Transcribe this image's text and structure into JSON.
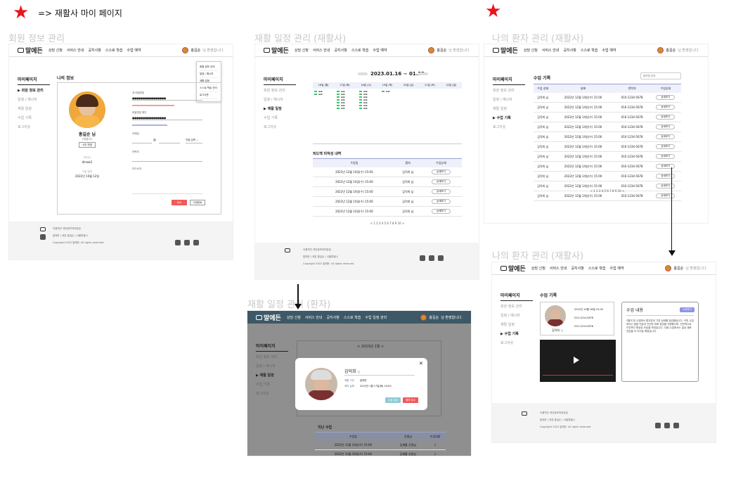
{
  "header": {
    "title": "=> 재활사 마이 페이지"
  },
  "sections": {
    "member_info": "회원 정보 관리",
    "schedule_therapist": "재활 일정 관리 (재활사)",
    "patient_mgmt": "나의 환자 관리 (재활사)",
    "schedule_patient": "재활 일정 관리 (환자)",
    "patient_mgmt2": "나의 환자 관리 (재활사)"
  },
  "nav": {
    "logo": "말에든",
    "menu": [
      "상담 신청",
      "서비스 안내",
      "공지사항",
      "스스로 학습",
      "수업 예약"
    ],
    "menu_patient": [
      "상담 신청",
      "서비스 안내",
      "공지사항",
      "스스로 학습",
      "수업 일정 관리"
    ],
    "user": "홍길순",
    "user_suffix": "님 환영합니다."
  },
  "sidebar": {
    "title": "마이페이지",
    "items": [
      "회원 정보 관리",
      "일정 / 예시자",
      "재활 일정",
      "수업 기록",
      "로그아웃"
    ]
  },
  "member": {
    "title": "나의 정보",
    "name": "홍길순 님",
    "role": "(재활사)",
    "photo_btn": "사진 변경",
    "id_label": "아이디",
    "id_value": "dhrwk2",
    "join_label": "가입 일자",
    "join_value": "2022년 10월 12일",
    "pw_label": "새 비밀번호",
    "pw_confirm_label": "비밀번호 확인",
    "pw_mask": "●●●●●●●●●●●●●●●●",
    "phone_label": "이메일",
    "address_label": "연락처",
    "intro_label": "자기소개",
    "cancel_btn": "취소",
    "save_btn": "수정완료",
    "dropdown": [
      "회원 정보 관리",
      "일정 / 예시자",
      "재활 일정",
      "스스로 학습 관리",
      "로그아웃"
    ]
  },
  "schedule": {
    "range": "2023.01.16 ~ 01.22",
    "days": [
      "16일 (월)",
      "17일 (화)",
      "18일 (수)",
      "19일 (목)",
      "20일 (금)",
      "21일 (토)",
      "22일 (일)"
    ],
    "feedback_title": "피드백 미작성 내역",
    "cols": [
      "수업일",
      "환자",
      "수업상세"
    ],
    "rows": [
      [
        "2022년 12월 14일(수) 15:00",
        "김덕희 님",
        "상세보기"
      ],
      [
        "2022년 12월 14일(수) 15:00",
        "김덕희 님",
        "상세보기"
      ],
      [
        "2022년 12월 14일(수) 15:00",
        "김덕희 님",
        "상세보기"
      ],
      [
        "2022년 12월 14일(수) 15:00",
        "김덕희 님",
        "상세보기"
      ],
      [
        "2022년 12월 14일(수) 15:00",
        "김덕희 님",
        "상세보기"
      ]
    ],
    "pager": "<  1 2 3 4 5 6 7 8 9 10  >"
  },
  "records": {
    "title": "수업 기록",
    "search_placeholder": "환자명 검색",
    "cols": [
      "수업 상태",
      "날짜",
      "연락처",
      "수업상세"
    ],
    "rows": [
      [
        "김덕희 님",
        "2022년 12월 14일(수) 15:00",
        "010-1234-5678",
        "상세보기"
      ],
      [
        "김덕희 님",
        "2022년 12월 14일(수) 15:00",
        "010-1234-5678",
        "상세보기"
      ],
      [
        "김덕희 님",
        "2022년 12월 14일(수) 15:00",
        "010-1234-5678",
        "상세보기"
      ],
      [
        "김덕희 님",
        "2022년 12월 14일(수) 15:00",
        "010-1234-5678",
        "상세보기"
      ],
      [
        "김덕희 님",
        "2022년 12월 14일(수) 15:00",
        "010-1234-5678",
        "상세보기"
      ],
      [
        "김덕희 님",
        "2022년 12월 14일(수) 15:00",
        "010-1234-5678",
        "상세보기"
      ],
      [
        "김덕희 님",
        "2022년 12월 14일(수) 15:00",
        "010-1234-5678",
        "상세보기"
      ],
      [
        "김덕희 님",
        "2022년 12월 14일(수) 15:00",
        "010-1234-5678",
        "상세보기"
      ],
      [
        "김덕희 님",
        "2022년 12월 14일(수) 15:00",
        "010-1234-5678",
        "상세보기"
      ],
      [
        "김덕희 님",
        "2022년 12월 14일(수) 15:00",
        "010-1234-5678",
        "상세보기"
      ],
      [
        "김덕희 님",
        "2022년 12월 14일(수) 15:00",
        "010-1234-5678",
        "상세보기"
      ]
    ],
    "pager": "<  1 2 3 4 5 6 7 8 9 10  >"
  },
  "detail": {
    "title": "수업 기록",
    "patient": "김덕희",
    "patient_suffix": "님",
    "content_title": "수업 내용",
    "badge": "수정하기",
    "content": "3월의 첫 수업에서 환자분의 기본 상태를 점검했습니다. 이번 수업에서는 발음 연습과 간단한 대화 훈련을 진행했으며, 전반적으로 이전보다 향상된 모습을 보였습니다. 다음 수업에서는 일상 대화 연습을 더 이어갈 예정입니다.",
    "date": "2022년 10월 16일 15:00",
    "phone": "010-1234-5678"
  },
  "patient_view": {
    "month": "2023년 1월",
    "modal_name": "김덕희",
    "modal_suffix": "님",
    "modal_label1": "재활 기관",
    "modal_value1": "말에든",
    "modal_label2": "예약 날짜",
    "modal_value2": "2023년 1월 17일(화) 10:00",
    "btn1": "수업 입장",
    "btn2": "예약 취소",
    "past_title": "지난 수업",
    "past_cols": [
      "수업일",
      "선생님",
      "수업내용"
    ],
    "past_rows": [
      [
        "2022년 12월 14일(수) 15:00",
        "김재활 선생님",
        "?"
      ],
      [
        "2022년 12월 14일(수) 15:00",
        "김재활 선생님",
        "?"
      ]
    ]
  },
  "footer": {
    "links": "이용약관    개인정보처리방침",
    "company": "말에든 | 대표 홍길순 | 서울특별시",
    "copy": "Copyright 2022 말에든. All rights reserved."
  },
  "colors": {
    "accent": "#8b93e6",
    "star": "#e8151b",
    "danger": "#f05a5a"
  }
}
